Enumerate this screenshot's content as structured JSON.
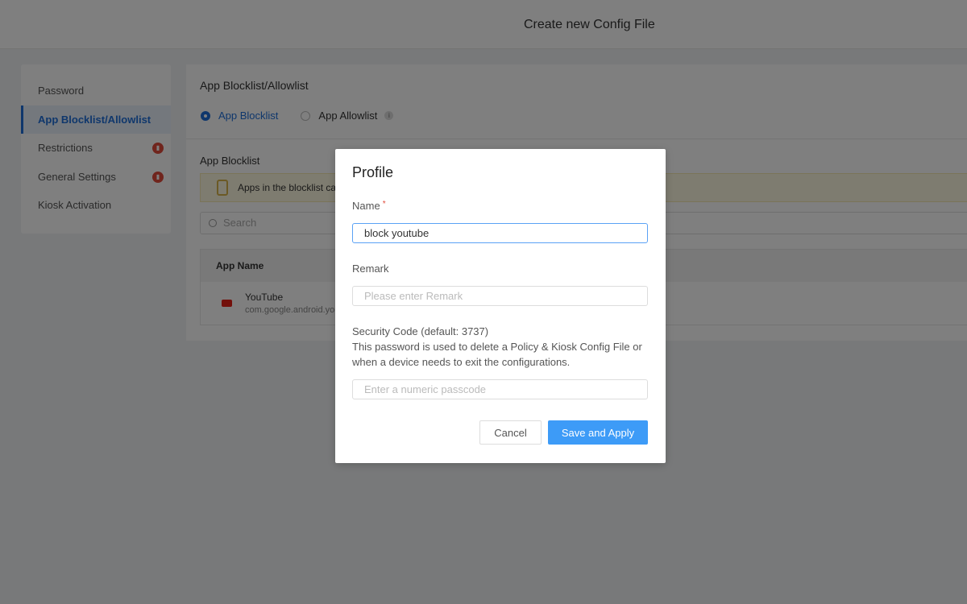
{
  "header": {
    "title": "Create new Config File"
  },
  "sidebar": {
    "items": [
      {
        "label": "Password",
        "active": false,
        "badge": false
      },
      {
        "label": "App Blocklist/Allowlist",
        "active": true,
        "badge": false
      },
      {
        "label": "Restrictions",
        "active": false,
        "badge": true
      },
      {
        "label": "General Settings",
        "active": false,
        "badge": true
      },
      {
        "label": "Kiosk Activation",
        "active": false,
        "badge": false
      }
    ]
  },
  "main": {
    "title": "App Blocklist/Allowlist",
    "radio_blocklist": "App Blocklist",
    "radio_allowlist": "App Allowlist",
    "selected": "App Blocklist",
    "section_title": "App Blocklist",
    "warning": "Apps in the blocklist car",
    "search_placeholder": "Search",
    "table": {
      "header": "App Name",
      "rows": [
        {
          "name": "YouTube",
          "package": "com.google.android.you"
        }
      ]
    }
  },
  "modal": {
    "title": "Profile",
    "name_label": "Name",
    "required_mark": "*",
    "name_value": "block youtube",
    "remark_label": "Remark",
    "remark_placeholder": "Please enter Remark",
    "security_label": "Security Code (default: 3737)",
    "security_desc": "This password is used to delete a Policy & Kiosk Config File or when a device needs to exit the configurations.",
    "passcode_placeholder": "Enter a numeric passcode",
    "cancel": "Cancel",
    "save": "Save and Apply"
  },
  "colors": {
    "accent": "#1e6ed8",
    "primary_button": "#3d9bf7",
    "badge": "#e04a3a"
  }
}
